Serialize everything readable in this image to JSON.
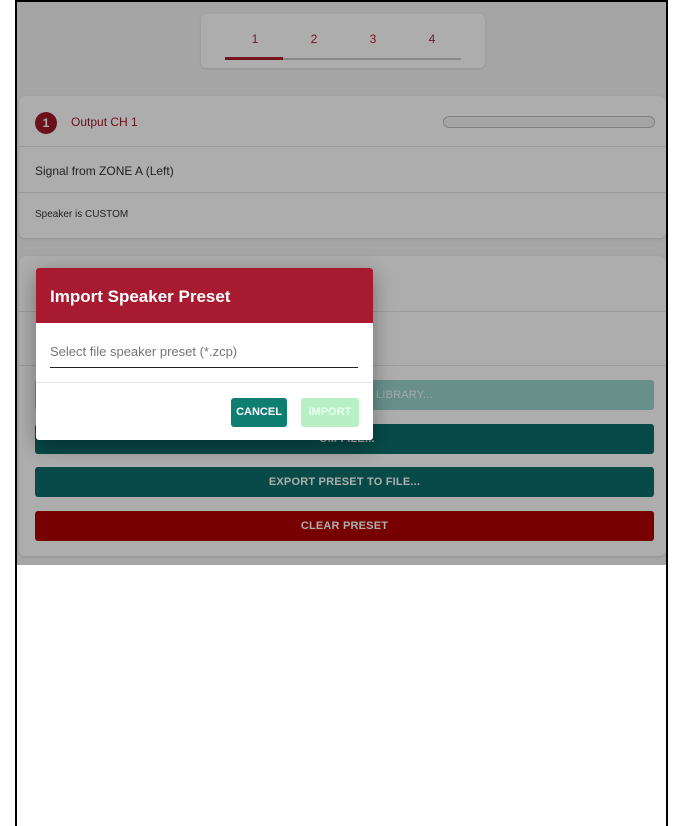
{
  "tabs": [
    "1",
    "2",
    "3",
    "4"
  ],
  "output": {
    "badge": "1",
    "title": "Output CH 1",
    "signal": "Signal from ZONE A (Left)",
    "speaker": "Speaker is CUSTOM",
    "level_fraction": 0.0
  },
  "preset": {
    "library_button_visible_fragment": "LIBRARY...",
    "import_from_file_visible_fragment": "OM FILE...",
    "export_button": "EXPORT PRESET TO FILE...",
    "clear_button": "CLEAR PRESET"
  },
  "dialog": {
    "title": "Import Speaker Preset",
    "file_placeholder": "Select file speaker preset (*.zcp)",
    "cancel": "CANCEL",
    "import": "IMPORT"
  },
  "colors": {
    "brand_red": "#a81a30",
    "teal": "#0b6e6a",
    "clear_red": "#b00000"
  }
}
